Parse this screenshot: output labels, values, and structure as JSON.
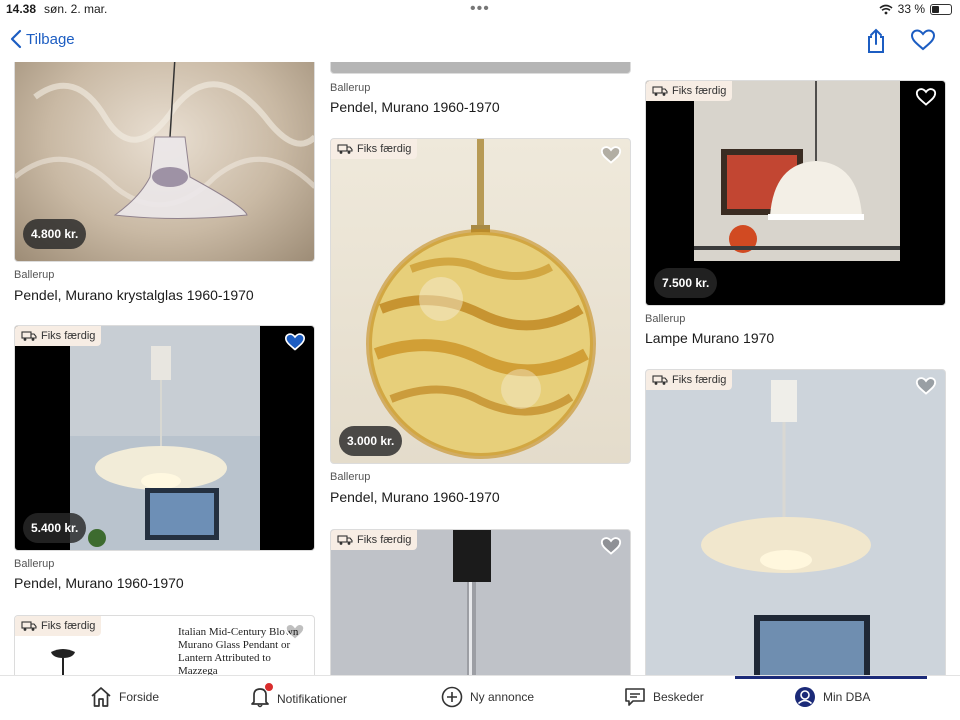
{
  "status": {
    "time": "14.38",
    "date": "søn. 2. mar.",
    "battery": "33 %"
  },
  "nav": {
    "back_label": "Tilbage"
  },
  "badge_label": "Fiks færdig",
  "listings": [
    {
      "price": "4.800 kr.",
      "location": "Ballerup",
      "title": "Pendel, Murano krystalglas 1960-1970"
    },
    {
      "location": "Ballerup",
      "title": "Pendel, Murano 1960-1970"
    },
    {
      "price": "7.500 kr.",
      "location": "Ballerup",
      "title": "Lampe Murano 1970"
    },
    {
      "price": "5.400 kr.",
      "location": "Ballerup",
      "title": "Pendel, Murano 1960-1970"
    },
    {
      "price": "3.000 kr.",
      "location": "Ballerup",
      "title": "Pendel, Murano 1960-1970"
    }
  ],
  "doc_card_text": [
    "Italian Mid-Century Blown",
    "Murano Glass Pendant or",
    "Lantern Attributed to",
    "Mazzega"
  ],
  "tabs": [
    {
      "label": "Forside",
      "icon": "home-icon"
    },
    {
      "label": "Notifikationer",
      "icon": "bell-icon"
    },
    {
      "label": "Ny annonce",
      "icon": "plus-circle-icon"
    },
    {
      "label": "Beskeder",
      "icon": "chat-icon"
    },
    {
      "label": "Min DBA",
      "icon": "profile-icon"
    }
  ],
  "colors": {
    "accent": "#1c5dc2",
    "active_tab": "#1b2a78",
    "badge_bg": "#f7ede4"
  }
}
